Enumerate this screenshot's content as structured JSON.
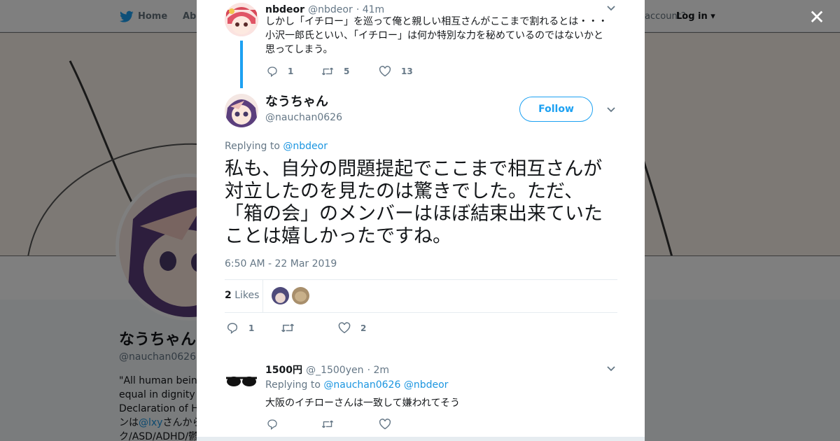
{
  "header": {
    "home_label": "Home",
    "about_label": "Abo",
    "account_prompt": "account?",
    "login_label": "Log in"
  },
  "profile": {
    "display_name": "なうちゃん",
    "handle": "@nauchan0626",
    "bio_line1": "\"All human beings",
    "bio_line2": "equal in dignity an",
    "bio_line3": "Declaration of Hum",
    "bio_line4_pre": "ンは",
    "bio_line4_link": "@lxy",
    "bio_line4_post": "さんから",
    "bio_line5": "ク/ASD/ADHD/鬱/"
  },
  "parent_tweet": {
    "name": "nbdeor",
    "handle": "@nbdeor",
    "time": "· 41m",
    "text_line1": "しかし「イチロー」を巡って俺と親しい相互さんがここまで割れるとは・・・",
    "text_line2": "小沢一郎氏といい、「イチロー」は何か特別な力を秘めているのではないかと",
    "text_line3": "思ってしまう。",
    "replies": "1",
    "retweets": "5",
    "likes": "13"
  },
  "main_tweet": {
    "name": "なうちゃん",
    "handle": "@nauchan0626",
    "follow_label": "Follow",
    "replying_label": "Replying to",
    "replying_to": "@nbdeor",
    "text_line1": "私も、自分の問題提起でここまで相互さんが",
    "text_line2": "対立したのを見たのは驚きでした。ただ、",
    "text_line3": "「箱の会」のメンバーはほぼ結束出来ていた",
    "text_line4": "ことは嬉しかったですね。",
    "timestamp": "6:50 AM - 22 Mar 2019",
    "likes_count": "2",
    "likes_label": "Likes",
    "replies": "1",
    "favorites": "2"
  },
  "reply_tweet": {
    "name": "1500円",
    "handle": "@_1500yen",
    "time": "· 2m",
    "replying_label": "Replying to",
    "replying_to_1": "@nauchan0626",
    "replying_to_2": "@nbdeor",
    "text": "大阪のイチローさんは一致して嫌われてそう"
  },
  "icons": [
    "twitter-bird-icon",
    "close-icon",
    "reply-icon",
    "retweet-icon",
    "heart-icon",
    "chevron-down-icon"
  ],
  "colors": {
    "accent": "#1da1f2",
    "link": "#1b95e0",
    "text": "#14171a",
    "muted": "#657786",
    "thread_line": "#1da1f2"
  }
}
